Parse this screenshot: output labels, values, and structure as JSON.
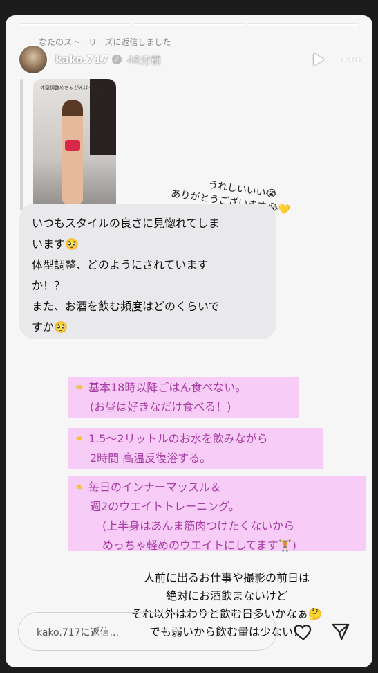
{
  "story": {
    "reply_note": "なたのストーリーズに返信しました",
    "username": "kako.717",
    "time_ago": "48分前",
    "thumb_caption": "体型調整めちゃがんばった。",
    "progress_segments": 3
  },
  "sticker": {
    "line1": "うれしいいい😭",
    "line2": "ありがとうございます😭💛"
  },
  "question": {
    "lines": [
      "いつもスタイルの良さに見惚れてしま",
      "います🥺",
      "体型調整、どのようにされています",
      "か！？",
      "また、お酒を飲む頻度はどのくらいで",
      "すか🥺"
    ]
  },
  "answers": {
    "a1": [
      "基本18時以降ごはん食べない。",
      "(お昼は好きなだけ食べる！)"
    ],
    "a2": [
      "1.5〜2リットルのお水を飲みながら",
      "2時間 高温反復浴する。"
    ],
    "a3": [
      "毎日のインナーマッスル＆",
      "週2のウエイトトレーニング。",
      "(上半身はあんま筋肉つけたくないから",
      "めっちゃ軽めのウエイトにしてます🏋️)"
    ],
    "star_icon": "star-icon"
  },
  "closing": {
    "lines": [
      "人前に出るお仕事や撮影の前日は",
      "絶対にお酒飲まないけど",
      "それ以外はわりと飲む日多いかなぁ🤔",
      "でも弱いから飲む量は少ない！"
    ]
  },
  "footer": {
    "reply_placeholder": "kako.717に返信..."
  },
  "colors": {
    "highlight_bg": "#f7cdf7",
    "highlight_text": "#a73ca3",
    "bubble_bg": "#e9e9ec"
  }
}
